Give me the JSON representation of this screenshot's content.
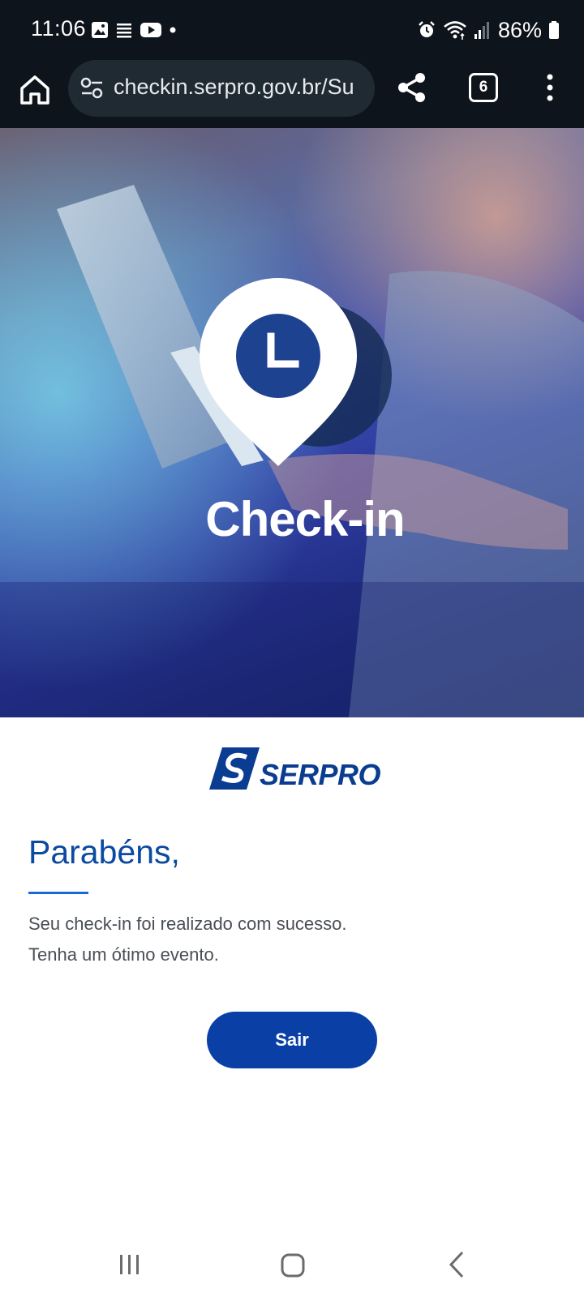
{
  "status_bar": {
    "time": "11:06",
    "battery": "86%",
    "left_icons": [
      "image-icon",
      "notes-icon",
      "youtube-icon",
      "dot-icon"
    ],
    "right_icons": [
      "alarm-icon",
      "wifi-icon",
      "signal-icon",
      "battery-icon"
    ]
  },
  "browser": {
    "url": "checkin.serpro.gov.br/Su",
    "tab_count": "6",
    "icons": [
      "home-icon",
      "site-settings-icon",
      "share-icon",
      "more-vert-icon"
    ]
  },
  "hero": {
    "title": "Check-in",
    "icon": "location-clock-icon"
  },
  "logo": {
    "text": "SERPRO"
  },
  "content": {
    "heading": "Parabéns,",
    "message_line1": "Seu check-in foi realizado com sucesso.",
    "message_line2": "Tenha um ótimo evento.",
    "button_label": "Sair"
  },
  "colors": {
    "accent": "#0a3fa6",
    "heading": "#0a4aa0",
    "status_bar_bg": "#0e141b"
  }
}
